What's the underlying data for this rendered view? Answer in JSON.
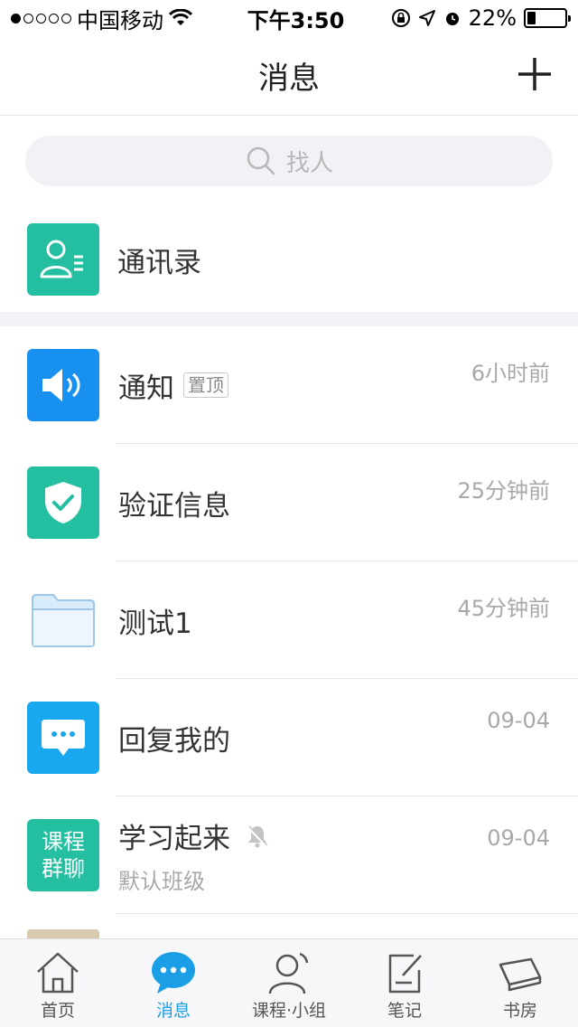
{
  "status_bar": {
    "carrier": "中国移动",
    "time": "下午3:50",
    "battery": "22%",
    "battery_level": 0.22
  },
  "nav": {
    "title": "消息",
    "add_icon": "plus-icon"
  },
  "search": {
    "placeholder": "找人",
    "icon": "search-icon"
  },
  "contacts": {
    "label": "通讯录",
    "icon": "contact-card-icon",
    "color": "#23bfa0"
  },
  "messages": [
    {
      "title": "通知",
      "badge": "置顶",
      "time": "6小时前",
      "icon": "speaker-icon",
      "color": "#1890f0"
    },
    {
      "title": "验证信息",
      "time": "25分钟前",
      "icon": "shield-check-icon",
      "color": "#23bfa0"
    },
    {
      "title": "测试1",
      "time": "45分钟前",
      "icon": "folder-icon",
      "color": "#d9ecfb"
    },
    {
      "title": "回复我的",
      "time": "09-04",
      "icon": "chat-bubble-icon",
      "color": "#18a8f0"
    },
    {
      "title": "学习起来",
      "subtitle": "默认班级",
      "time": "09-04",
      "icon_text_line1": "课程",
      "icon_text_line2": "群聊",
      "muted_icon": "bell-off-icon",
      "color": "#23bfa0"
    }
  ],
  "tabs": [
    {
      "label": "首页",
      "icon": "home-icon",
      "active": false
    },
    {
      "label": "消息",
      "icon": "message-icon",
      "active": true
    },
    {
      "label": "课程·小组",
      "icon": "person-icon",
      "active": false
    },
    {
      "label": "笔记",
      "icon": "note-icon",
      "active": false
    },
    {
      "label": "书房",
      "icon": "book-icon",
      "active": false
    }
  ],
  "colors": {
    "accent": "#1a9fe6",
    "teal": "#23bfa0"
  }
}
